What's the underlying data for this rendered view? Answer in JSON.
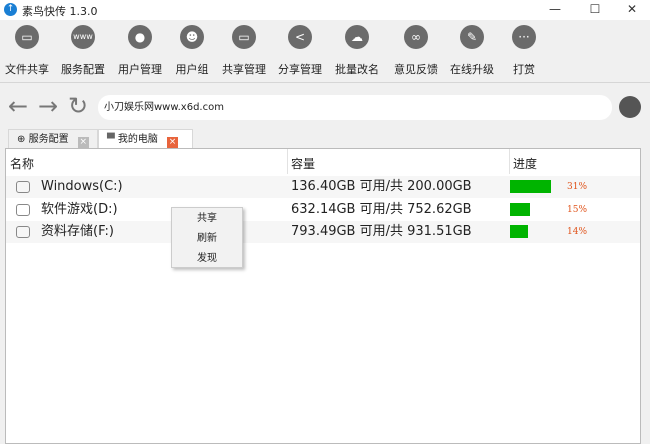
{
  "window": {
    "title": "素鸟快传 1.3.0",
    "minimize": "—",
    "maximize": "☐",
    "close": "✕"
  },
  "toolbar": [
    {
      "label": "文件共享",
      "icon": "monitor-icon",
      "glyph": "▭"
    },
    {
      "label": "服务配置",
      "icon": "www-globe-icon",
      "glyph": "www"
    },
    {
      "label": "用户管理",
      "icon": "user-icon",
      "glyph": "●"
    },
    {
      "label": "用户组",
      "icon": "user-group-icon",
      "glyph": "☻"
    },
    {
      "label": "共享管理",
      "icon": "folder-icon",
      "glyph": "▭"
    },
    {
      "label": "分享管理",
      "icon": "share-icon",
      "glyph": "<"
    },
    {
      "label": "批量改名",
      "icon": "cloud-icon",
      "glyph": "☁"
    },
    {
      "label": "意见反馈",
      "icon": "link-icon",
      "glyph": "∞"
    },
    {
      "label": "在线升级",
      "icon": "pencil-icon",
      "glyph": "✎"
    },
    {
      "label": "打赏",
      "icon": "chat-icon",
      "glyph": "···"
    }
  ],
  "nav": {
    "back": "←",
    "forward": "→",
    "refresh": "↻",
    "address": "小刀娱乐网www.x6d.com"
  },
  "tabs": [
    {
      "label": "服务配置",
      "icon": "globe-icon",
      "glyph": "⊕"
    },
    {
      "label": "我的电脑",
      "icon": "computer-icon",
      "glyph": "▀"
    }
  ],
  "table": {
    "headers": [
      "名称",
      "容量",
      "进度"
    ],
    "rows": [
      {
        "name": "Windows(C:)",
        "capacity": "136.40GB 可用/共 200.00GB",
        "percent": 31,
        "percent_label": "31%"
      },
      {
        "name": "软件游戏(D:)",
        "capacity": "632.14GB 可用/共 752.62GB",
        "percent": 15,
        "percent_label": "15%"
      },
      {
        "name": "资料存储(F:)",
        "capacity": "793.49GB 可用/共 931.51GB",
        "percent": 14,
        "percent_label": "14%"
      }
    ]
  },
  "context_menu": [
    "共享",
    "刷新",
    "发现"
  ],
  "colors": {
    "progress": "#00b400",
    "percent_text": "#e0531a",
    "tab_close_active": "#e8643c"
  }
}
